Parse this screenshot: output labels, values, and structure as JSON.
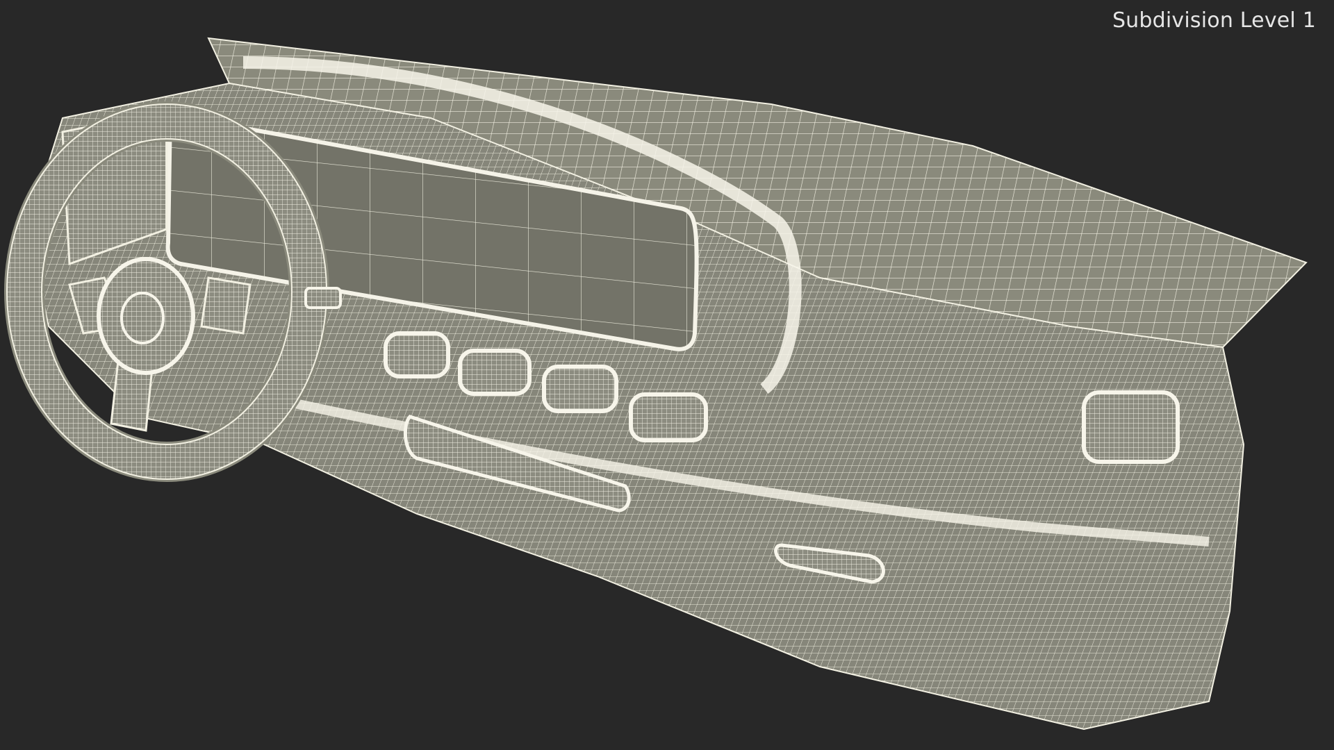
{
  "viewport": {
    "label": "Subdivision Level 1",
    "background_color": "#282828",
    "mesh_fill_color": "#8a8a7c",
    "wire_color": "#f2f0e2"
  },
  "model": {
    "icon": "dashboard-wireframe-icon"
  }
}
